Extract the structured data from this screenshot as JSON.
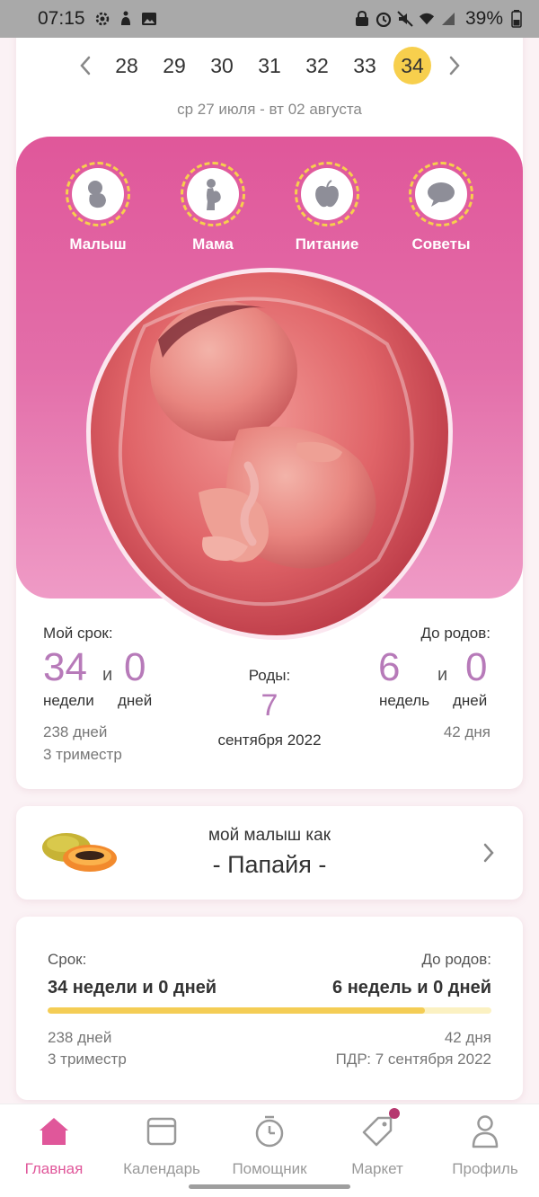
{
  "status_bar": {
    "time": "07:15",
    "battery_percent": "39%",
    "icons_left": [
      "settings-icon",
      "accessibility-icon",
      "image-icon"
    ],
    "icons_right": [
      "lock-icon",
      "alarm-icon",
      "mute-icon",
      "wifi-icon",
      "signal-icon",
      "battery-icon"
    ]
  },
  "week_selector": {
    "weeks": [
      "28",
      "29",
      "30",
      "31",
      "32",
      "33",
      "34"
    ],
    "selected": "34",
    "date_range": "ср 27 июля - вт 02 августа"
  },
  "categories": [
    {
      "label": "Малыш",
      "icon": "baby-icon"
    },
    {
      "label": "Мама",
      "icon": "pregnant-mother-icon"
    },
    {
      "label": "Питание",
      "icon": "apple-icon"
    },
    {
      "label": "Советы",
      "icon": "chat-bubble-icon"
    }
  ],
  "stats": {
    "my_term_label": "Мой срок:",
    "weeks_value": "34",
    "and": "и",
    "days_value": "0",
    "weeks_unit": "недели",
    "days_unit": "дней",
    "total_days": "238 дней",
    "trimester": "3 триместр",
    "birth_label": "Роды:",
    "birth_day": "7",
    "birth_month_year": "сентября 2022",
    "until_birth_label": "До родов:",
    "remaining_weeks": "6",
    "remaining_days": "0",
    "remaining_weeks_unit": "недель",
    "remaining_days_unit": "дней",
    "remaining_total_days": "42 дня"
  },
  "baby_size": {
    "subtitle": "мой малыш как",
    "fruit": "- Папайя -"
  },
  "progress": {
    "term_label": "Срок:",
    "term_value": "34 недели и 0 дней",
    "until_label": "До родов:",
    "until_value": "6 недель и 0 дней",
    "fraction": 0.85,
    "days_passed": "238 дней",
    "trimester": "3 триместр",
    "days_left": "42 дня",
    "due_date": "ПДР: 7 сентября 2022"
  },
  "bottom_nav": [
    {
      "label": "Главная",
      "icon": "home-icon",
      "active": true
    },
    {
      "label": "Календарь",
      "icon": "calendar-icon",
      "active": false
    },
    {
      "label": "Помощник",
      "icon": "timer-icon",
      "active": false
    },
    {
      "label": "Маркет",
      "icon": "tag-icon",
      "active": false,
      "badge": true
    },
    {
      "label": "Профиль",
      "icon": "profile-icon",
      "active": false
    }
  ],
  "colors": {
    "accent_pink": "#e0579a",
    "accent_yellow": "#f7cf4d",
    "stat_purple": "#b77ab9"
  }
}
